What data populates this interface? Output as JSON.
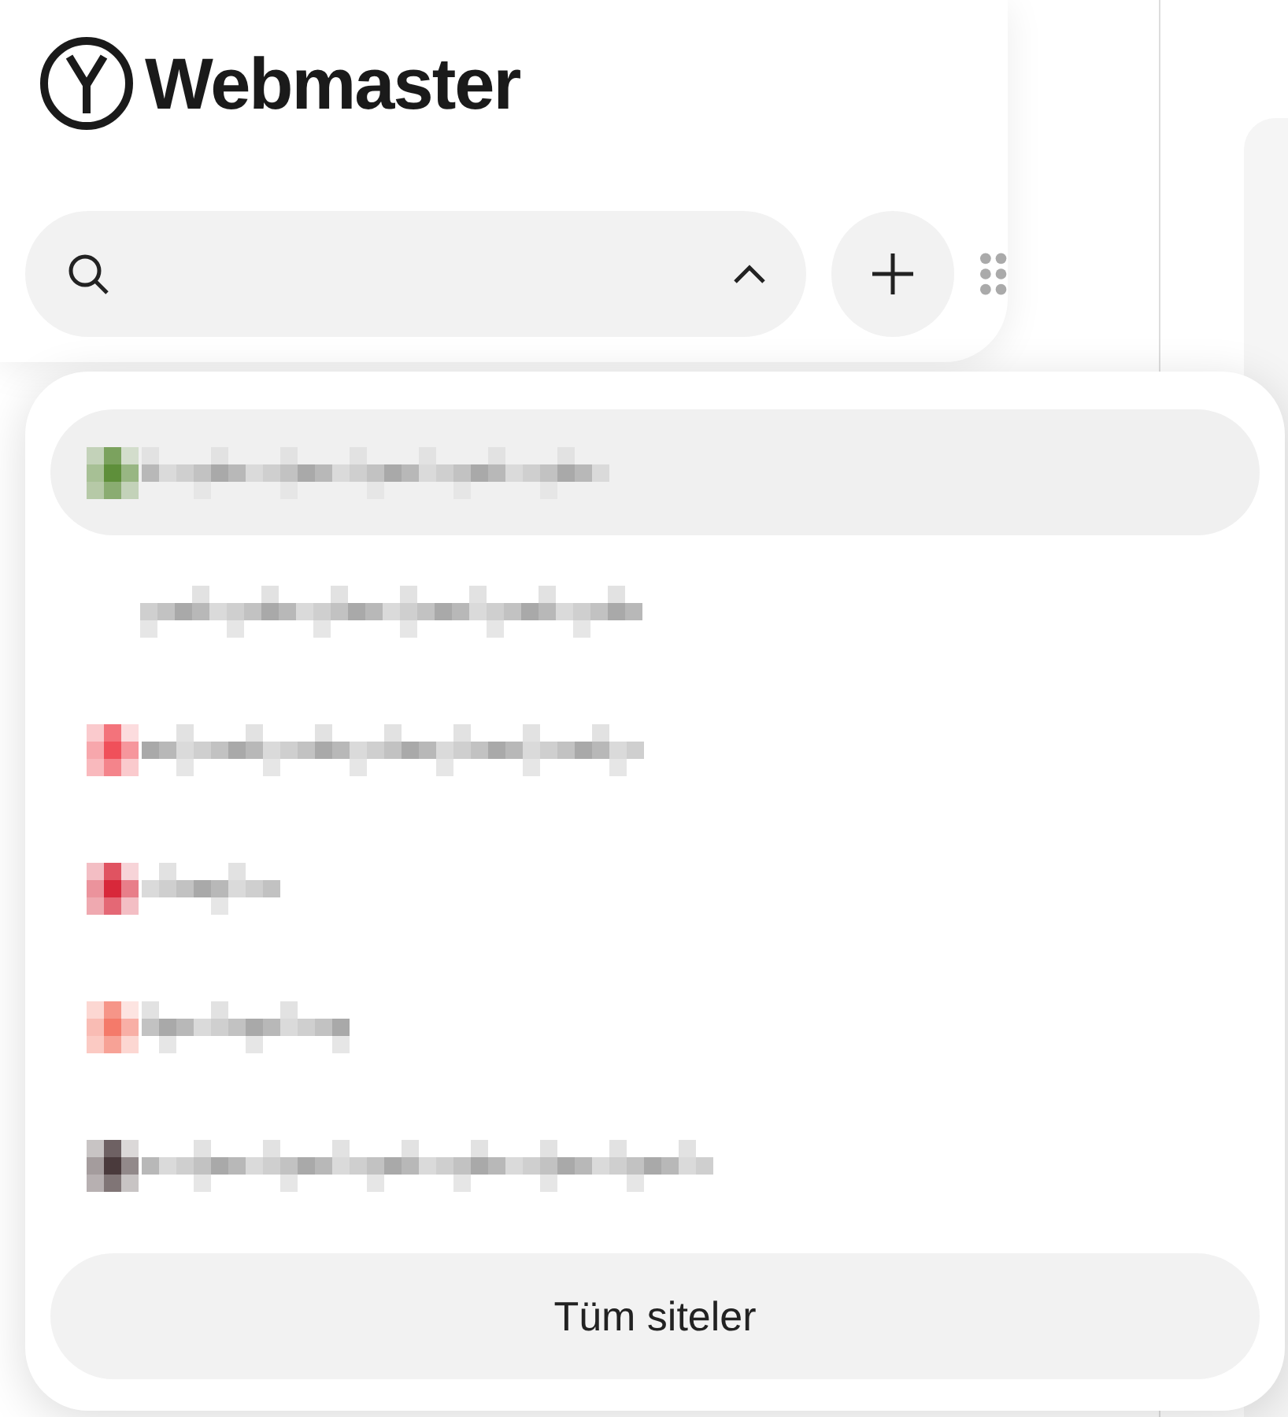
{
  "brand": {
    "name": "Webmaster"
  },
  "search": {
    "expanded": true
  },
  "sites": [
    {
      "selected": true,
      "color": "#5e8f3a"
    },
    {
      "selected": false
    },
    {
      "selected": false,
      "color": "#f0505a"
    },
    {
      "selected": false,
      "color": "#d8283a"
    },
    {
      "selected": false,
      "color": "#f47a6a"
    },
    {
      "selected": false,
      "color": "#4a3a3c"
    }
  ],
  "all_sites_button": {
    "label": "Tüm siteler"
  }
}
